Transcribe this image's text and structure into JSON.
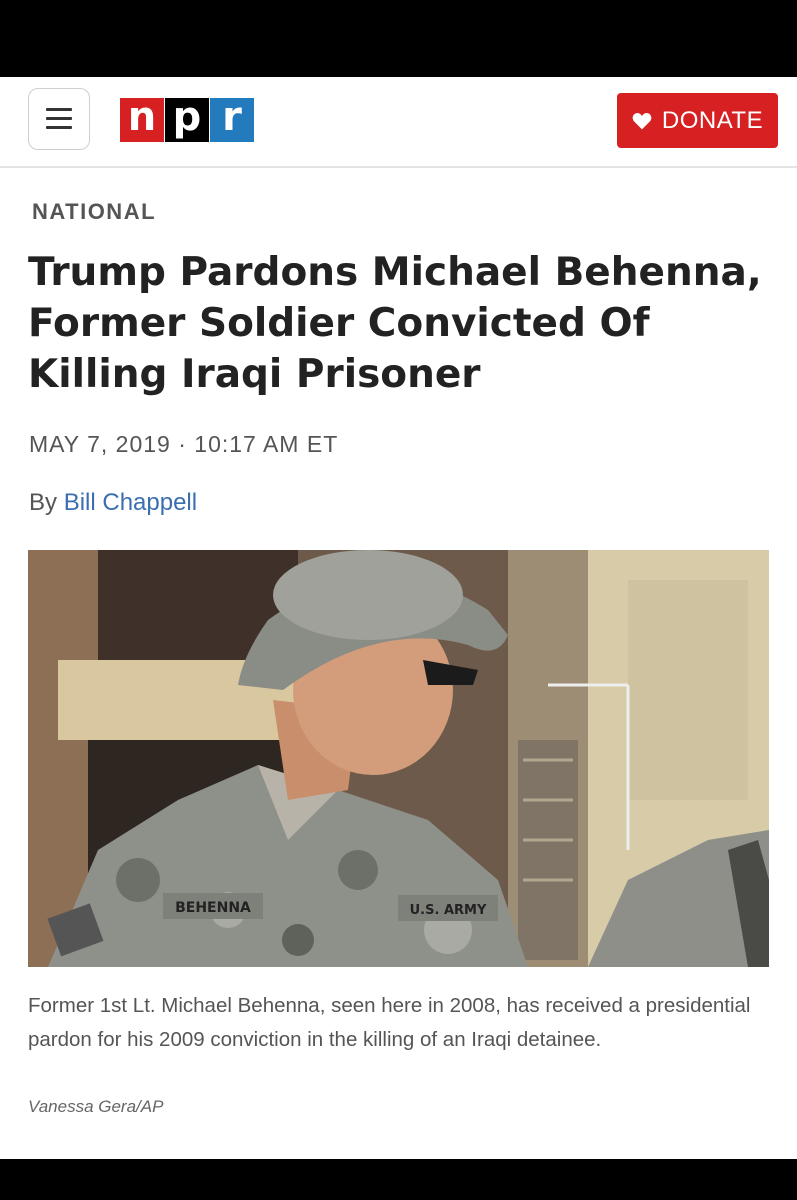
{
  "header": {
    "menu_icon": "hamburger-menu-icon",
    "logo": {
      "letters": [
        "n",
        "p",
        "r"
      ],
      "colors": [
        "#d62021",
        "#000000",
        "#237bbd"
      ]
    },
    "donate_label": "DONATE",
    "donate_icon": "heart-icon",
    "accent_color": "#d62021"
  },
  "article": {
    "section": "NATIONAL",
    "headline": "Trump Pardons Michael Behenna, Former Soldier Convicted Of Killing Iraqi Prisoner",
    "dateline": "MAY 7, 2019 · 10:17 AM ET",
    "byline_prefix": "By",
    "author": "Bill Chappell",
    "author_color": "#3b6eb0"
  },
  "photo": {
    "name_tape": "BEHENNA",
    "branch_tape": "U.S. ARMY",
    "caption": "Former 1st Lt. Michael Behenna, seen here in 2008, has received a presidential pardon for his 2009 conviction in the killing of an Iraqi detainee.",
    "credit": "Vanessa Gera/AP"
  }
}
